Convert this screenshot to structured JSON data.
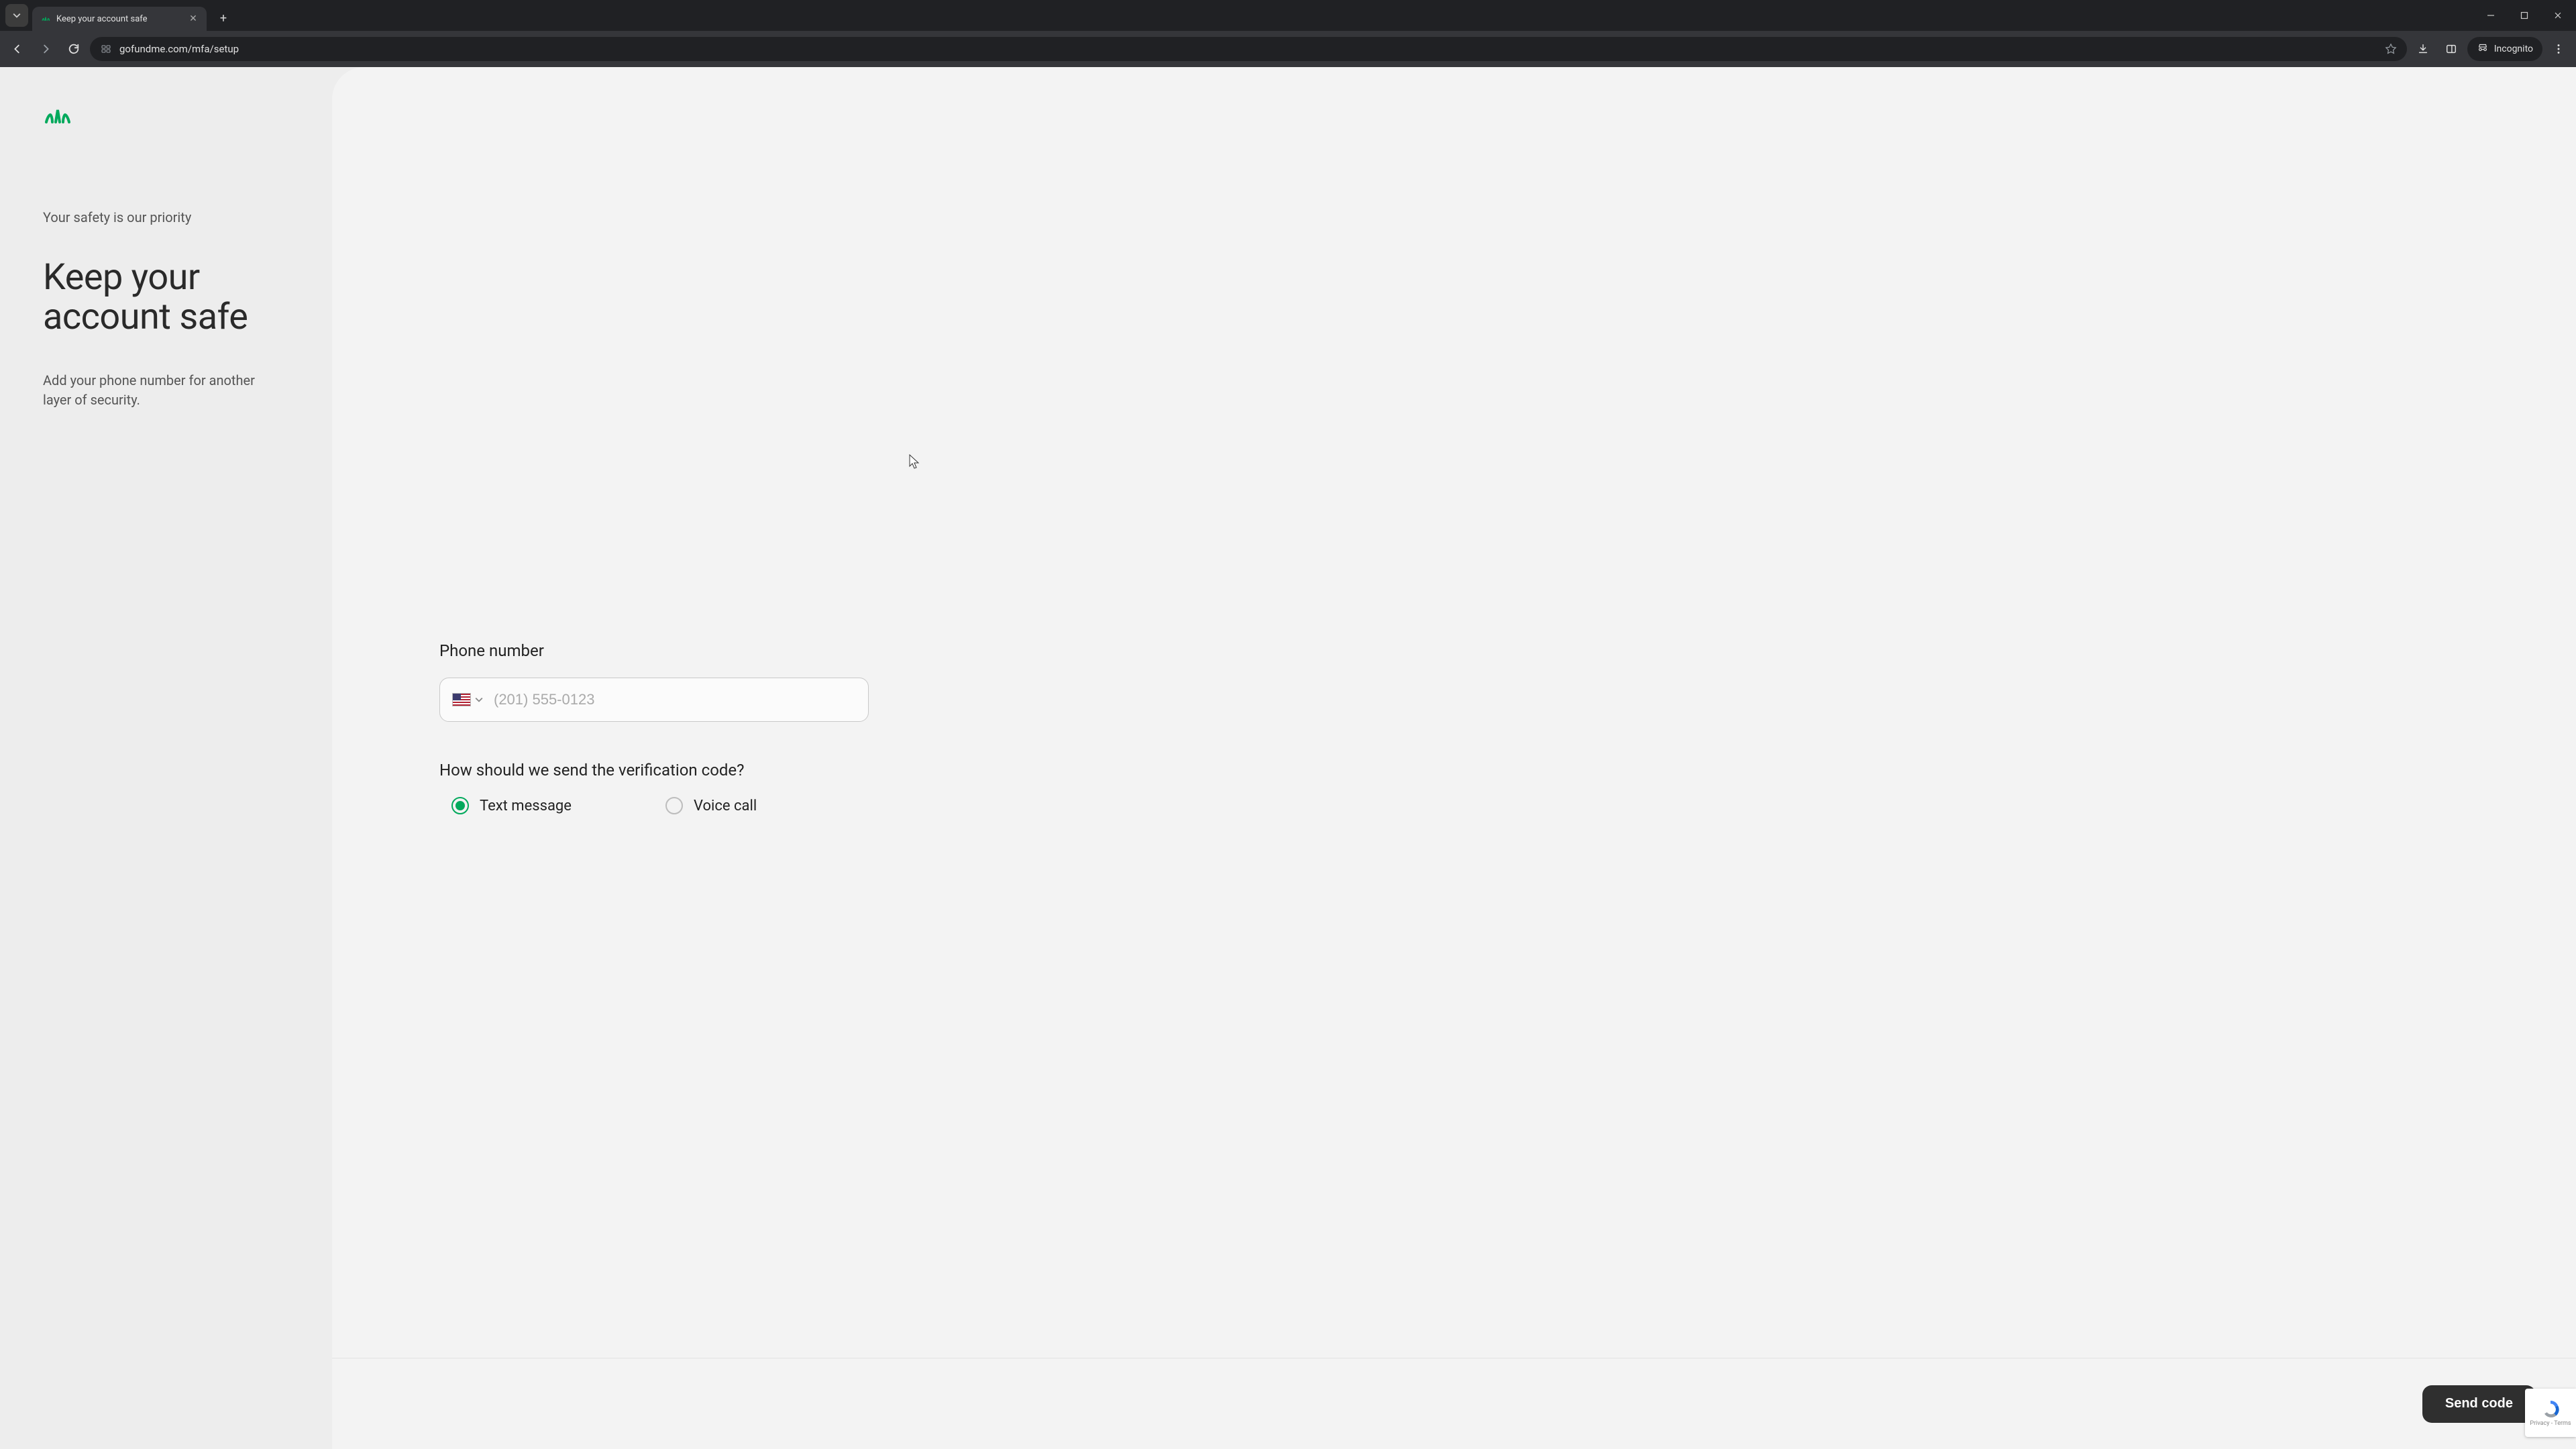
{
  "browser": {
    "tab_title": "Keep your account safe",
    "url": "gofundme.com/mfa/setup",
    "incognito_label": "Incognito"
  },
  "page": {
    "kicker": "Your safety is our priority",
    "title": "Keep your account safe",
    "subtext": "Add your phone number for another layer of security.",
    "phone_label": "Phone number",
    "phone_placeholder": "(201) 555-0123",
    "phone_value": "",
    "phone_country_flag": "us",
    "verify_label": "How should we send the verification code?",
    "radio_options": [
      {
        "label": "Text message",
        "value": "sms",
        "selected": true
      },
      {
        "label": "Voice call",
        "value": "voice",
        "selected": false
      }
    ],
    "send_button": "Send code",
    "recaptcha_links": "Privacy - Terms"
  },
  "colors": {
    "accent_green": "#02a95c",
    "page_bg_left": "#ededed",
    "page_bg_right": "#f3f3f3",
    "btn_dark": "#2f2f2f"
  }
}
